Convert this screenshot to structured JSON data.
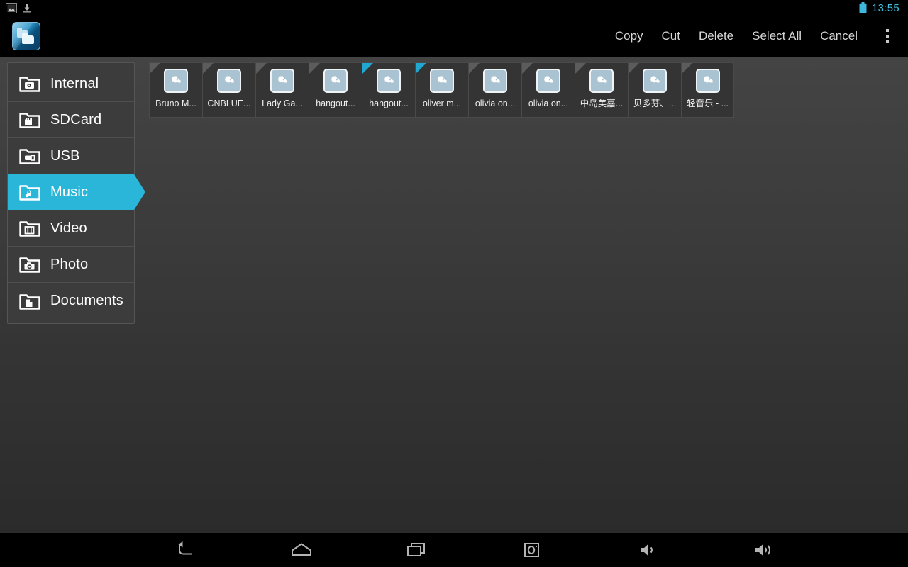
{
  "status_bar": {
    "icons": [
      "screenshot-notification-icon",
      "download-icon"
    ],
    "battery_icon": "battery-icon",
    "clock": "13:55",
    "accent_color": "#41bfe0"
  },
  "action_bar": {
    "app_icon": "file-manager-app-icon",
    "actions": [
      {
        "label": "Copy",
        "name": "copy"
      },
      {
        "label": "Cut",
        "name": "cut"
      },
      {
        "label": "Delete",
        "name": "delete"
      },
      {
        "label": "Select All",
        "name": "select-all"
      },
      {
        "label": "Cancel",
        "name": "cancel"
      }
    ],
    "overflow_icon": "overflow-menu-icon"
  },
  "sidebar": {
    "selected_color": "#29b6d8",
    "items": [
      {
        "label": "Internal",
        "icon": "folder-internal-storage-icon",
        "selected": false
      },
      {
        "label": "SDCard",
        "icon": "folder-sdcard-icon",
        "selected": false
      },
      {
        "label": "USB",
        "icon": "folder-usb-icon",
        "selected": false
      },
      {
        "label": "Music",
        "icon": "folder-music-icon",
        "selected": true
      },
      {
        "label": "Video",
        "icon": "folder-video-icon",
        "selected": false
      },
      {
        "label": "Photo",
        "icon": "folder-photo-icon",
        "selected": false
      },
      {
        "label": "Documents",
        "icon": "folder-documents-icon",
        "selected": false
      }
    ]
  },
  "file_grid": {
    "thumb_icon": "puzzle-piece-icon",
    "files": [
      {
        "name": "Bruno M...",
        "selected": false
      },
      {
        "name": "CNBLUE...",
        "selected": false
      },
      {
        "name": "Lady Ga...",
        "selected": false
      },
      {
        "name": "hangout...",
        "selected": false
      },
      {
        "name": "hangout...",
        "selected": true
      },
      {
        "name": "oliver m...",
        "selected": true
      },
      {
        "name": "olivia on...",
        "selected": false
      },
      {
        "name": "olivia on...",
        "selected": false
      },
      {
        "name": "中岛美嘉...",
        "selected": false
      },
      {
        "name": "贝多芬、...",
        "selected": false
      },
      {
        "name": "轻音乐 - ...",
        "selected": false
      }
    ]
  },
  "nav_bar": {
    "buttons": [
      {
        "name": "back-icon"
      },
      {
        "name": "home-icon"
      },
      {
        "name": "recents-icon"
      },
      {
        "name": "screenshot-icon"
      },
      {
        "name": "volume-down-icon"
      },
      {
        "name": "volume-up-icon"
      }
    ]
  }
}
